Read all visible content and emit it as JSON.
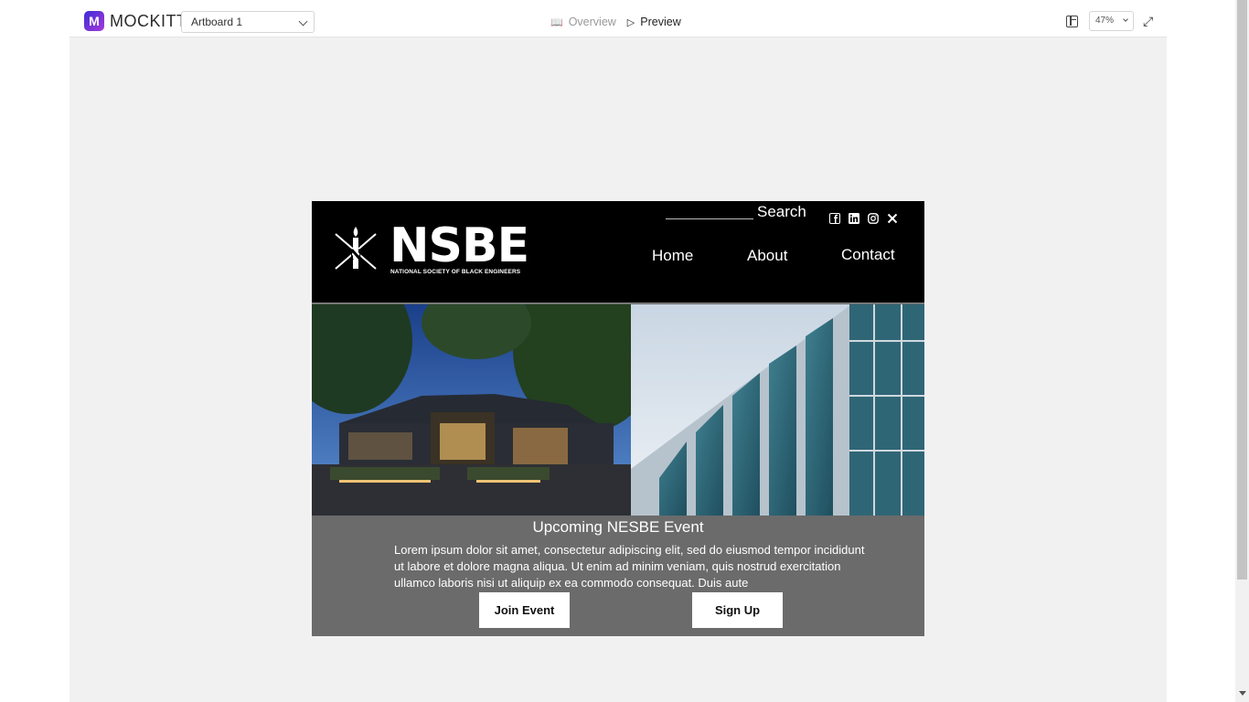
{
  "app": {
    "brand_letter": "M",
    "brand_name": "MOCKITT",
    "artboard_select": "Artboard 1",
    "modes": [
      {
        "label": "Overview",
        "icon": "book-icon",
        "active": false
      },
      {
        "label": "Preview",
        "icon": "play-icon",
        "active": true
      }
    ],
    "zoom": "47%",
    "brand_gradient": [
      "#3c2bd6",
      "#a63ad8"
    ]
  },
  "site": {
    "logo_text": "NSBE",
    "logo_subtitle": "NATIONAL SOCIETY OF BLACK ENGINEERS",
    "search_label": "Search",
    "socials": [
      "facebook-icon",
      "linkedin-icon",
      "instagram-icon",
      "x-icon"
    ],
    "nav": [
      "Home",
      "About",
      "Contact"
    ],
    "event": {
      "title": "Upcoming NESBE Event",
      "body": "Lorem ipsum dolor sit amet, consectetur adipiscing elit, sed do eiusmod tempor incididunt ut labore et dolore magna aliqua. Ut enim ad minim veniam, quis nostrud exercitation ullamco laboris nisi ut aliquip ex ea commodo consequat. Duis aute",
      "join_button": "Join Event",
      "signup_button": "Sign Up"
    },
    "colors": {
      "header": "#000000",
      "event_bg": "#6b6b6b",
      "canvas": "#f1f1f1"
    }
  }
}
